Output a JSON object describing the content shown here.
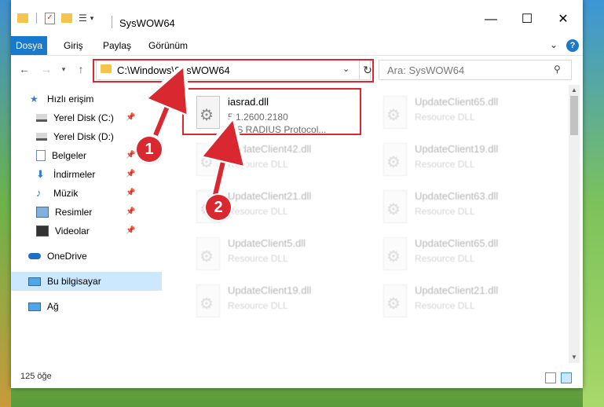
{
  "window": {
    "title": "SysWOW64"
  },
  "ribbon": {
    "tabs": [
      "Dosya",
      "Giriş",
      "Paylaş",
      "Görünüm"
    ],
    "help": "?"
  },
  "navigation": {
    "address": "C:\\Windows\\SysWOW64",
    "search_placeholder": "Ara: SysWOW64"
  },
  "sidebar": {
    "items": [
      {
        "label": "Hızlı erişim",
        "icon": "star-icon"
      },
      {
        "label": "Yerel Disk (C:)",
        "icon": "drive-icon",
        "pinned": true
      },
      {
        "label": "Yerel Disk (D:)",
        "icon": "drive-icon"
      },
      {
        "label": "Belgeler",
        "icon": "documents-icon",
        "pinned": true
      },
      {
        "label": "İndirmeler",
        "icon": "download-icon",
        "pinned": true
      },
      {
        "label": "Müzik",
        "icon": "music-icon",
        "pinned": true
      },
      {
        "label": "Resimler",
        "icon": "pictures-icon",
        "pinned": true
      },
      {
        "label": "Videolar",
        "icon": "video-icon",
        "pinned": true
      },
      {
        "label": "OneDrive",
        "icon": "cloud-icon"
      },
      {
        "label": "Bu bilgisayar",
        "icon": "computer-icon",
        "selected": true
      },
      {
        "label": "Ağ",
        "icon": "network-icon"
      }
    ]
  },
  "files": [
    {
      "name": "iasrad.dll",
      "version": "5.1.2600.2180",
      "desc": "IAS RADIUS Protocol..."
    },
    {
      "name": "UpdateClient65.dll",
      "desc": "Resource DLL"
    },
    {
      "name": "UpdateClient42.dll",
      "desc": "Resource DLL"
    },
    {
      "name": "UpdateClient19.dll",
      "desc": "Resource DLL"
    },
    {
      "name": "UpdateClient21.dll",
      "desc": "Resource DLL"
    },
    {
      "name": "UpdateClient63.dll",
      "desc": "Resource DLL"
    },
    {
      "name": "UpdateClient5.dll",
      "desc": "Resource DLL"
    },
    {
      "name": "UpdateClient65.dll",
      "desc": "Resource DLL"
    },
    {
      "name": "UpdateClient19.dll",
      "desc": "Resource DLL"
    },
    {
      "name": "UpdateClient21.dll",
      "desc": "Resource DLL"
    }
  ],
  "status": {
    "item_count": "125 öğe"
  },
  "annotations": {
    "callout1": "1",
    "callout2": "2",
    "color": "#d9282f"
  }
}
